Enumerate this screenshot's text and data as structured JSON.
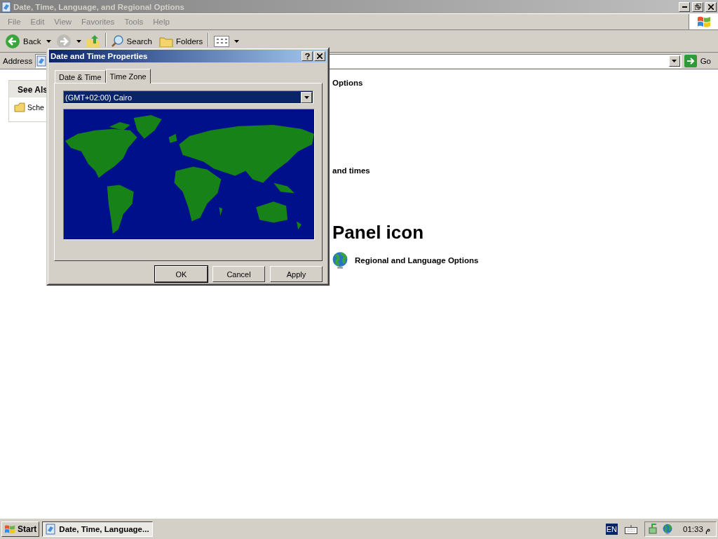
{
  "window": {
    "title": "Date, Time, Language, and Regional Options"
  },
  "menu": [
    "File",
    "Edit",
    "View",
    "Favorites",
    "Tools",
    "Help"
  ],
  "toolbar": {
    "back": "Back",
    "search": "Search",
    "folders": "Folders"
  },
  "address": {
    "label": "Address",
    "go": "Go"
  },
  "see_also": {
    "title": "See Als",
    "items": [
      "Sche"
    ]
  },
  "content": {
    "task_title": "Options",
    "task_item": "and times",
    "heading": "Panel icon",
    "icon_link": "Regional and Language Options"
  },
  "dialog": {
    "title": "Date and Time Properties",
    "tabs": [
      {
        "label": "Date & Time",
        "selected": false
      },
      {
        "label": "Time Zone",
        "selected": true
      }
    ],
    "time_zone": "(GMT+02:00) Cairo",
    "buttons": [
      "OK",
      "Cancel",
      "Apply"
    ]
  },
  "taskbar": {
    "start": "Start",
    "tasks": [
      {
        "label": "Date, Time, Language...",
        "selected": true
      }
    ],
    "language": "EN",
    "clock": "01:33 م"
  }
}
